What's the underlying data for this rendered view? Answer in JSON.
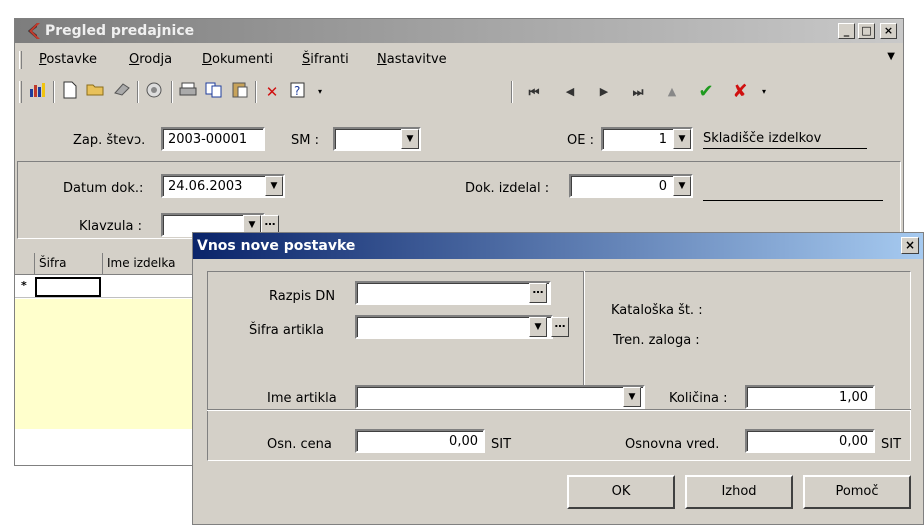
{
  "main_window": {
    "title": "Pregled predajnice",
    "controls": {
      "minimize": "_",
      "maximize": "□",
      "close": "×"
    }
  },
  "menu": {
    "items": [
      {
        "label_u": "P",
        "label_rest": "ostavke"
      },
      {
        "label_u": "O",
        "label_rest": "rodja"
      },
      {
        "label_u": "D",
        "label_rest": "okumenti"
      },
      {
        "label_u": "Š",
        "label_rest": "ifranti"
      },
      {
        "label_u": "N",
        "label_rest": "astavitve"
      }
    ],
    "overflow_arrow": "▼"
  },
  "toolbar": {
    "left_icons": [
      "chart-icon",
      "new-document-icon",
      "open-folder-icon",
      "eraser-icon",
      "settings-icon",
      "print-icon",
      "copy-icon",
      "paste-icon",
      "delete-icon",
      "help-icon"
    ],
    "nav_icons": [
      "first-icon",
      "previous-icon",
      "next-icon",
      "last-icon",
      "up-icon",
      "confirm-icon",
      "cancel-icon"
    ]
  },
  "header_form": {
    "zap_stev_label": "Zap. števↄ.",
    "zap_stev_value": "2003-00001",
    "sm_label": "SM :",
    "sm_value": "",
    "oe_label": "OE :",
    "oe_value": "1",
    "oe_name": "Skladišče izdelkov",
    "datum_label": "Datum dok.:",
    "datum_value": "24.06.2003",
    "izdelal_label": "Dok. izdelal :",
    "izdelal_value": "0",
    "izdelal_name": "",
    "klavzula_label": "Klavzula :",
    "klavzula_value": ""
  },
  "grid": {
    "columns": [
      "Šifra",
      "Ime izdelka"
    ],
    "row_marker": "*"
  },
  "dialog": {
    "title": "Vnos nove postavke",
    "close": "×",
    "razpis_label": "Razpis DN",
    "razpis_value": "",
    "sifra_label": "Šifra artikla",
    "sifra_value": "",
    "kataloska_label": "Kataloška št. :",
    "zaloga_label": "Tren. zaloga :",
    "ime_label": "Ime artikla",
    "ime_value": "",
    "kolicina_label": "Količina :",
    "kolicina_value": "1,00",
    "osn_cena_label": "Osn. cena",
    "osn_cena_value": "0,00",
    "currency": "SIT",
    "osn_vred_label": "Osnovna vred.",
    "osn_vred_value": "0,00",
    "buttons": {
      "ok": "OK",
      "izhod": "Izhod",
      "pomoc": "Pomoč"
    }
  }
}
